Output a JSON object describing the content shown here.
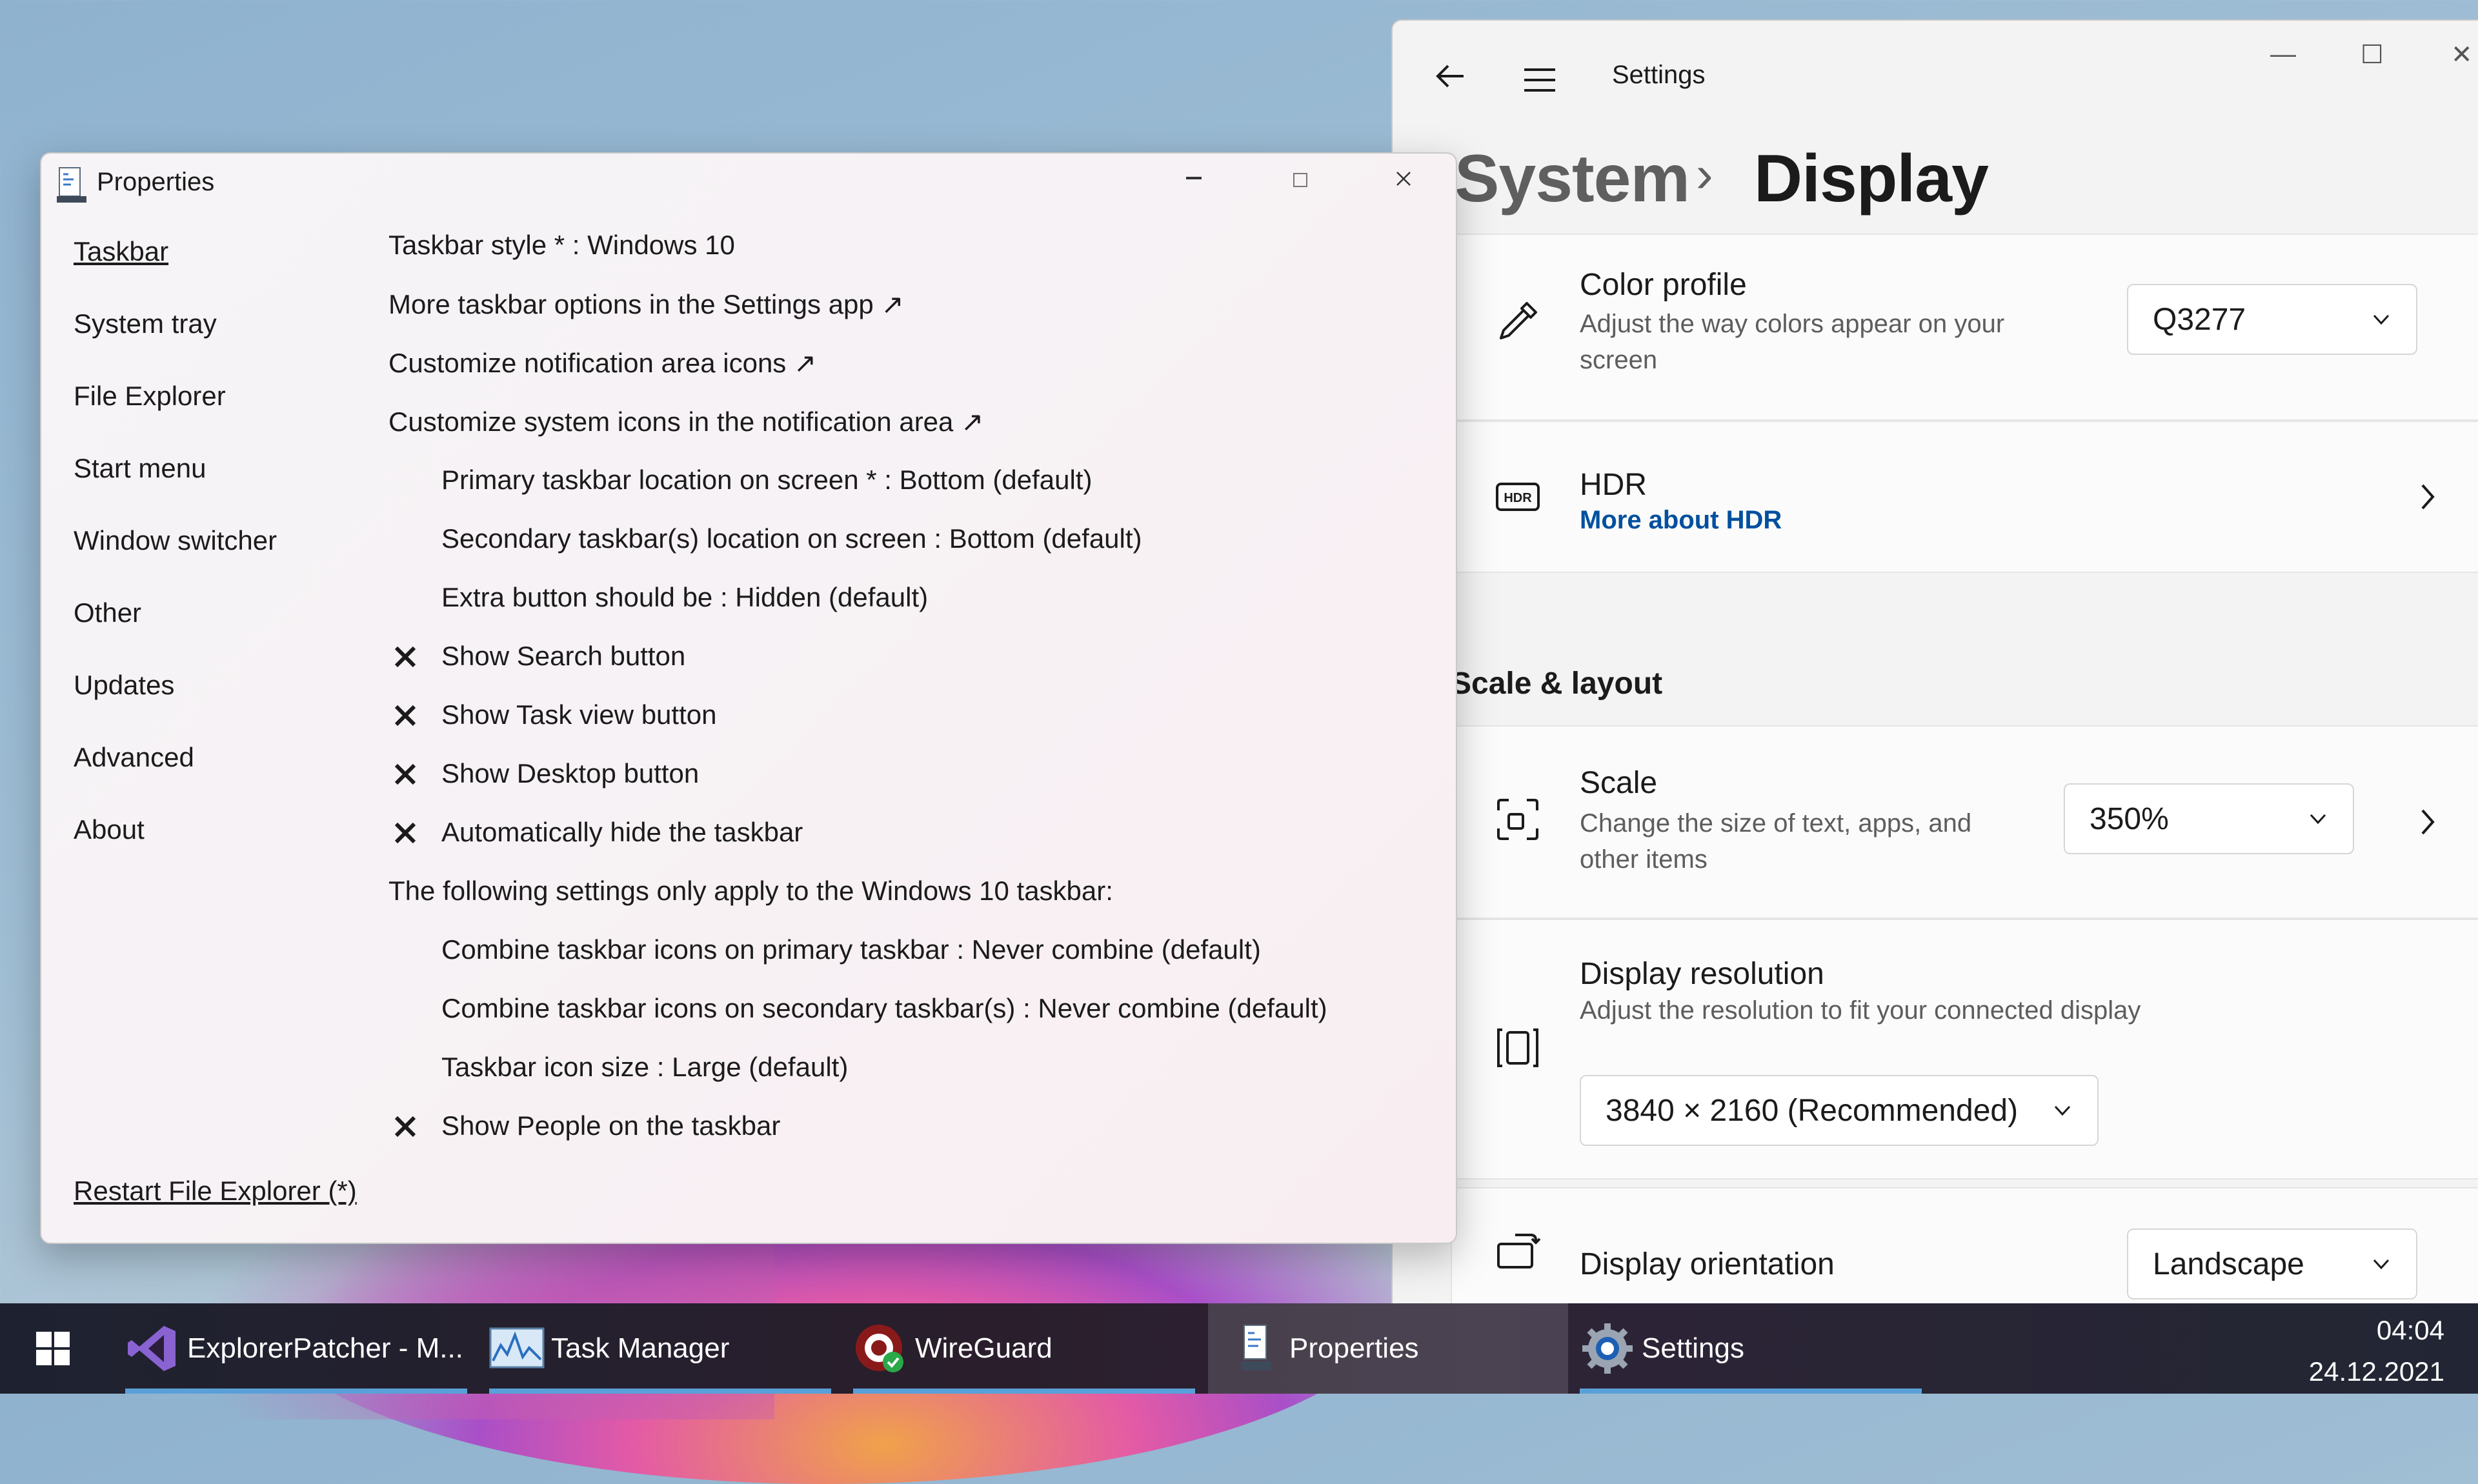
{
  "settings": {
    "app_title": "Settings",
    "breadcrumb_parent": "System",
    "breadcrumb_sep": "›",
    "breadcrumb_current": "Display",
    "window_min": "—",
    "window_max": "☐",
    "window_close": "✕",
    "color_profile": {
      "title": "Color profile",
      "desc": "Adjust the way colors appear on your screen",
      "value": "Q3277"
    },
    "hdr": {
      "title": "HDR",
      "link": "More about HDR",
      "icon_text": "HDR"
    },
    "scale_layout_heading": "Scale & layout",
    "scale": {
      "title": "Scale",
      "desc": "Change the size of text, apps, and other items",
      "value": "350%"
    },
    "resolution": {
      "title": "Display resolution",
      "desc": "Adjust the resolution to fit your connected display",
      "value": "3840 × 2160 (Recommended)"
    },
    "orientation": {
      "title": "Display orientation",
      "value": "Landscape"
    }
  },
  "properties": {
    "title": "Properties",
    "nav": [
      "Taskbar",
      "System tray",
      "File Explorer",
      "Start menu",
      "Window switcher",
      "Other",
      "Updates",
      "Advanced",
      "About"
    ],
    "selected_nav": "Taskbar",
    "options": [
      {
        "text": "Taskbar style * : Windows 10",
        "indent": false,
        "x": false
      },
      {
        "text": "More taskbar options in the Settings app ↗",
        "indent": false,
        "x": false
      },
      {
        "text": "Customize notification area icons ↗",
        "indent": false,
        "x": false
      },
      {
        "text": "Customize system icons in the notification area ↗",
        "indent": false,
        "x": false
      },
      {
        "text": "Primary taskbar location on screen * : Bottom (default)",
        "indent": true,
        "x": false
      },
      {
        "text": "Secondary taskbar(s) location on screen : Bottom (default)",
        "indent": true,
        "x": false
      },
      {
        "text": "Extra button should be : Hidden (default)",
        "indent": true,
        "x": false
      },
      {
        "text": "Show Search button",
        "indent": true,
        "x": true
      },
      {
        "text": "Show Task view button",
        "indent": true,
        "x": true
      },
      {
        "text": "Show Desktop button",
        "indent": true,
        "x": true
      },
      {
        "text": "Automatically hide the taskbar",
        "indent": true,
        "x": true
      },
      {
        "text": "The following settings only apply to the Windows 10 taskbar:",
        "indent": false,
        "x": false
      },
      {
        "text": "Combine taskbar icons on primary taskbar : Never combine (default)",
        "indent": true,
        "x": false
      },
      {
        "text": "Combine taskbar icons on secondary taskbar(s) : Never combine (default)",
        "indent": true,
        "x": false
      },
      {
        "text": "Taskbar icon size : Large (default)",
        "indent": true,
        "x": false
      },
      {
        "text": "Show People on the taskbar",
        "indent": true,
        "x": true
      }
    ],
    "restart_link": "Restart File Explorer (*)"
  },
  "taskbar": {
    "items": [
      {
        "label": "ExplorerPatcher - M...",
        "icon": "visual-studio-icon",
        "active": false
      },
      {
        "label": "Task Manager",
        "icon": "task-manager-icon",
        "active": false
      },
      {
        "label": "WireGuard",
        "icon": "wireguard-icon",
        "active": false
      },
      {
        "label": "Properties",
        "icon": "properties-icon",
        "active": true
      },
      {
        "label": "Settings",
        "icon": "settings-gear-icon",
        "active": false
      }
    ],
    "time": "04:04",
    "date": "24.12.2021"
  },
  "colors": {
    "accent": "#5aa0d8",
    "link": "#00509e",
    "taskbar_bg": "#1e2230"
  }
}
